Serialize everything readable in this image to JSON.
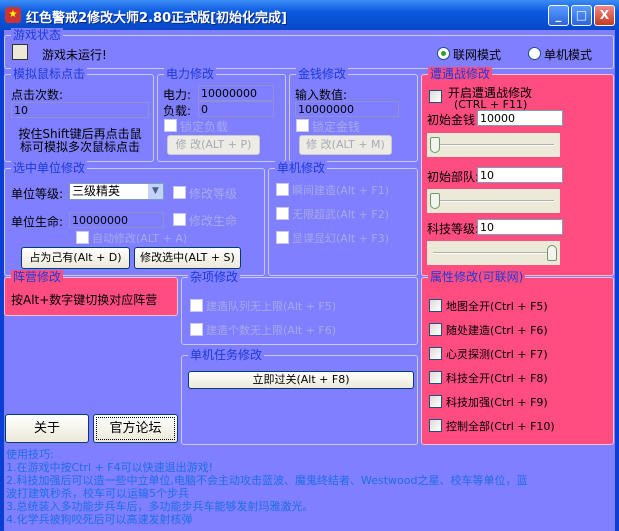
{
  "window": {
    "title": "红色警戒2修改大师2.80正式版[初始化完成]",
    "minimize": "_",
    "maximize": "□",
    "close": "X"
  },
  "status": {
    "title": "游戏状态",
    "text": "游戏未运行!",
    "radio_online": "联网模式",
    "radio_single": "单机模式",
    "selected": "online"
  },
  "mouse": {
    "title": "模拟鼠标点击",
    "count_label": "点击次数:",
    "count_value": "10",
    "hint1": "按住Shift键后再点击鼠",
    "hint2": "标可模拟多次鼠标点击"
  },
  "power": {
    "title": "电力修改",
    "power_label": "电力:",
    "power_value": "10000000",
    "load_label": "负载:",
    "load_value": "0",
    "lock": "锁定负载",
    "button": "修 改(ALT + P)"
  },
  "money": {
    "title": "金钱修改",
    "input_label": "输入数值:",
    "value": "10000000",
    "lock": "锁定金钱",
    "button": "修 改(ALT + M)"
  },
  "skirmish": {
    "title": "遭遇战修改",
    "enable": "开启遭遇战修改",
    "hotkey": "(CTRL + F11)",
    "money_label": "初始金钱",
    "money_value": "10000",
    "units_label": "初始部队:",
    "units_value": "10",
    "tech_label": "科技等级:",
    "tech_value": "10",
    "money_slider": 0,
    "units_slider": 0,
    "tech_slider": 1
  },
  "unit": {
    "title": "选中单位修改",
    "level_label": "单位等级:",
    "level_value": "三级精英",
    "mod_level": "修改等级",
    "life_label": "单位生命:",
    "life_value": "10000000",
    "mod_life": "修改生命",
    "auto": "自动修改(ALT + A)",
    "own_button": "占为己有(Alt + D)",
    "modify_button": "修改选中(ALT + S)"
  },
  "single": {
    "title": "单机修改",
    "items": [
      "瞬间建造(Alt + F1)",
      "无限超武(Alt + F2)",
      "显谍显幻(Alt + F3)"
    ]
  },
  "faction": {
    "title": "阵营修改",
    "text": "按Alt+数字键切换对应阵营"
  },
  "misc": {
    "title": "杂项修改",
    "items": [
      "建造队列无上限(Alt + F5)",
      "建造个数无上限(Alt + F6)"
    ]
  },
  "mission": {
    "title": "单机任务修改",
    "button": "立即过关(Alt + F8)"
  },
  "attr": {
    "title": "属性修改(可联网)",
    "items": [
      "地图全开(Ctrl + F5)",
      "随处建造(Ctrl + F6)",
      "心灵探测(Ctrl + F7)",
      "科技全开(Ctrl + F8)",
      "科技加强(Ctrl + F9)",
      "控制全部(Ctrl + F10)"
    ]
  },
  "footer": {
    "about": "关于",
    "forum": "官方论坛"
  },
  "tips": {
    "title": "使用技巧:",
    "lines": [
      "1.在游戏中按Ctrl + F4可以快速退出游戏!",
      "2.科技加强后可以造一些中立单位,电脑不会主动攻击蓝波、魔鬼终结者、Westwood之星、校车等单位，蓝",
      "波打建筑秒杀，校车可以运输5个步兵",
      "3.总统装入多功能步兵车后，多功能步兵车能够发射玛雅激光。",
      "4.化学兵被狗咬死后可以高速发射核弹"
    ]
  }
}
